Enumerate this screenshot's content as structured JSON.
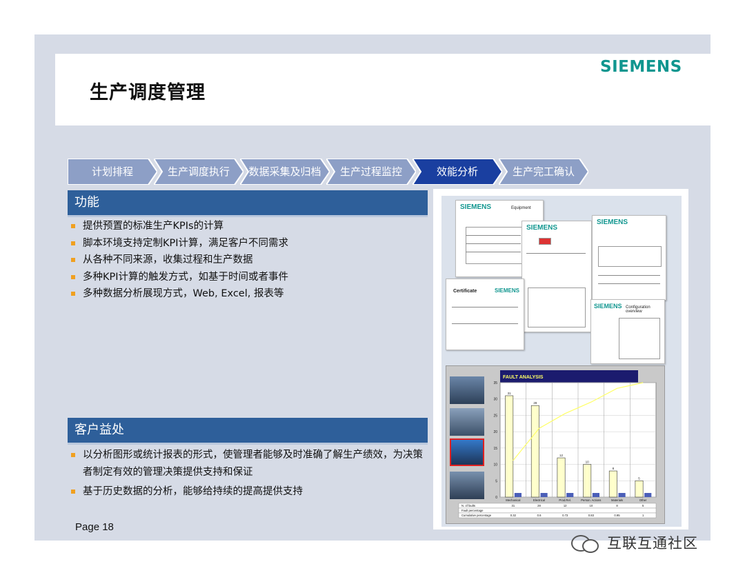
{
  "slide": {
    "title": "生产调度管理",
    "brand": "SIEMENS",
    "page_label": "Page 18",
    "accent_color": "#2e5f9a",
    "brand_color": "#10968f"
  },
  "process_steps": [
    {
      "label": "计划排程",
      "active": false
    },
    {
      "label": "生产调度执行",
      "active": false
    },
    {
      "label": "数据采集及归档",
      "active": false
    },
    {
      "label": "生产过程监控",
      "active": false
    },
    {
      "label": "效能分析",
      "active": true
    },
    {
      "label": "生产完工确认",
      "active": false
    }
  ],
  "functions": {
    "heading": "功能",
    "items": [
      "提供预置的标准生产KPIs的计算",
      "脚本环境支持定制KPI计算，满足客户不同需求",
      "从各种不同来源，收集过程和生产数据",
      "多种KPI计算的触发方式，如基于时间或者事件",
      "多种数据分析展现方式，Web, Excel, 报表等"
    ]
  },
  "benefits": {
    "heading": "客户益处",
    "items": [
      "以分析图形或统计报表的形式，使管理者能够及时准确了解生产绩效，为决策者制定有效的管理决策提供支持和保证",
      "基于历史数据的分析，能够给持续的提高提供支持"
    ]
  },
  "documents": {
    "doc1_brand": "SIEMENS",
    "doc1_title": "Equipment",
    "doc2_brand": "SIEMENS",
    "doc3_brand": "SIEMENS",
    "doc4_title": "Certificate",
    "doc4_brand": "SIEMENS",
    "doc5_brand": "SIEMENS",
    "doc5_title": "Configuration overview"
  },
  "chart_data": {
    "type": "bar",
    "title": "FAULT ANALYSIS",
    "categories": [
      "Mechanical",
      "Electrical",
      "Prod.Rel.",
      "Person. Actions",
      "Materials",
      "Other"
    ],
    "series": [
      {
        "name": "N. of faults",
        "values": [
          31,
          28,
          12,
          10,
          8,
          5
        ]
      }
    ],
    "cumulative_percentage": [
      0.32,
      0.6,
      0.73,
      0.83,
      0.95,
      1.0
    ],
    "ylim": [
      0,
      35
    ],
    "y2lim": [
      0,
      1
    ],
    "ytick_labels": [
      "0",
      "5",
      "10",
      "15",
      "20",
      "25",
      "30",
      "35"
    ],
    "table_rows": [
      "N. of faults",
      "Fault percentage",
      "Cumulative percentage"
    ],
    "bar_color": "#ffffcc",
    "line_color": "#ffff66"
  },
  "watermark": {
    "text": "互联互通社区"
  }
}
